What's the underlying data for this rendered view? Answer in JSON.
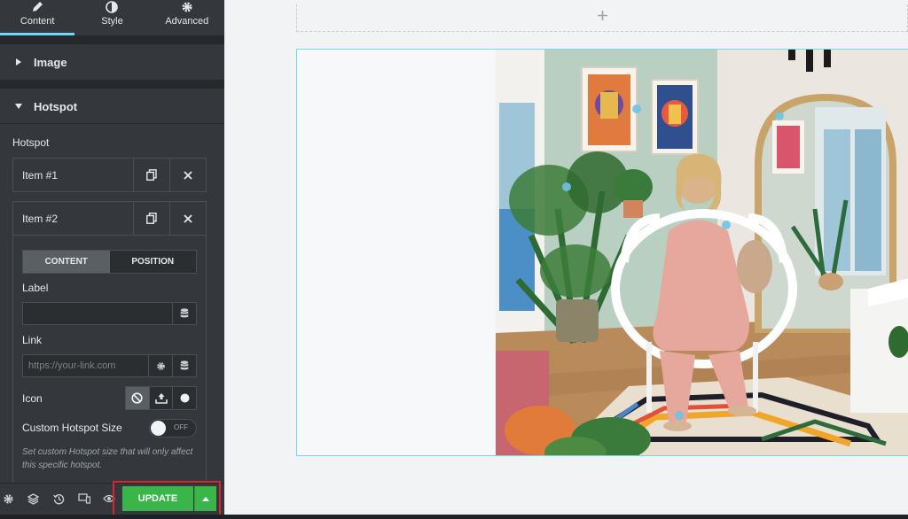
{
  "panel": {
    "tabs": [
      {
        "label": "Content",
        "icon": "pencil-icon"
      },
      {
        "label": "Style",
        "icon": "contrast-icon"
      },
      {
        "label": "Advanced",
        "icon": "gear-icon"
      }
    ],
    "sections": {
      "image": "Image",
      "hotspot": "Hotspot"
    },
    "hotspot_label": "Hotspot",
    "items": [
      {
        "title": "Item #1"
      },
      {
        "title": "Item #2"
      }
    ],
    "item_tabs": {
      "content": "CONTENT",
      "position": "POSITION"
    },
    "label_field": {
      "label": "Label",
      "value": ""
    },
    "link_field": {
      "label": "Link",
      "placeholder": "https://your-link.com"
    },
    "icon_label": "Icon",
    "custom_size": {
      "label": "Custom Hotspot Size",
      "toggle": "OFF"
    },
    "description": "Set custom Hotspot size that will only affect this specific hotspot.",
    "footer": {
      "update_label": "UPDATE"
    }
  },
  "colors": {
    "panel_bg": "#34383c",
    "accent": "#71d7f7",
    "update_green": "#39b54a",
    "highlight_red": "#d9262c"
  }
}
